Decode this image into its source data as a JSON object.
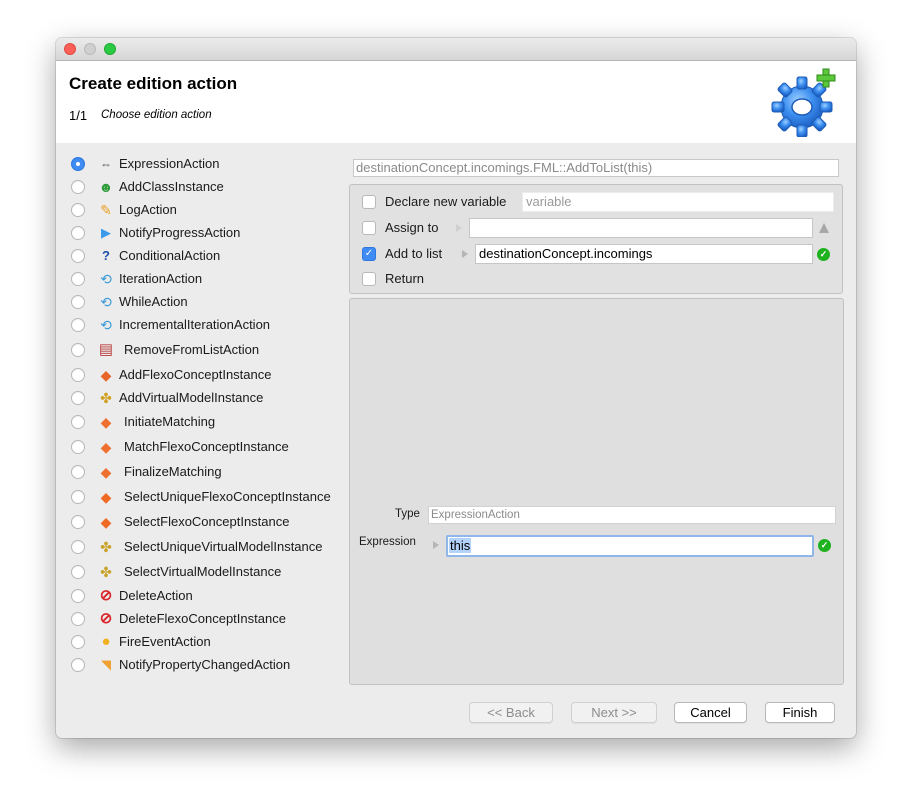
{
  "window": {
    "title": "Create edition action",
    "step": "1/1",
    "step_description": "Choose edition action",
    "header_icon": "gear-add-icon"
  },
  "actions": [
    {
      "label": "ExpressionAction",
      "icon": "expression-icon",
      "selected": true
    },
    {
      "label": "AddClassInstance",
      "icon": "add-class-icon",
      "selected": false
    },
    {
      "label": "LogAction",
      "icon": "pencil-icon",
      "selected": false
    },
    {
      "label": "NotifyProgressAction",
      "icon": "play-triangle-icon",
      "selected": false
    },
    {
      "label": "ConditionalAction",
      "icon": "question-icon",
      "selected": false
    },
    {
      "label": "IterationAction",
      "icon": "loop-icon",
      "selected": false
    },
    {
      "label": "WhileAction",
      "icon": "loop-icon",
      "selected": false
    },
    {
      "label": "IncrementalIterationAction",
      "icon": "loop-icon",
      "selected": false
    },
    {
      "label": "RemoveFromListAction",
      "icon": "remove-from-list-icon",
      "selected": false
    },
    {
      "label": "AddFlexoConceptInstance",
      "icon": "add-flexo-concept-icon",
      "selected": false
    },
    {
      "label": "AddVirtualModelInstance",
      "icon": "add-virtual-model-icon",
      "selected": false
    },
    {
      "label": "InitiateMatching",
      "icon": "matching-icon",
      "selected": false
    },
    {
      "label": "MatchFlexoConceptInstance",
      "icon": "matching-icon",
      "selected": false
    },
    {
      "label": "FinalizeMatching",
      "icon": "matching-icon",
      "selected": false
    },
    {
      "label": "SelectUniqueFlexoConceptInstance",
      "icon": "select-flexo-concept-icon",
      "selected": false
    },
    {
      "label": "SelectFlexoConceptInstance",
      "icon": "select-flexo-concept-icon",
      "selected": false
    },
    {
      "label": "SelectUniqueVirtualModelInstance",
      "icon": "select-virtual-model-icon",
      "selected": false
    },
    {
      "label": "SelectVirtualModelInstance",
      "icon": "select-virtual-model-icon",
      "selected": false
    },
    {
      "label": "DeleteAction",
      "icon": "delete-icon",
      "selected": false
    },
    {
      "label": "DeleteFlexoConceptInstance",
      "icon": "delete-icon",
      "selected": false
    },
    {
      "label": "FireEventAction",
      "icon": "fire-event-icon",
      "selected": false
    },
    {
      "label": "NotifyPropertyChangedAction",
      "icon": "notify-property-icon",
      "selected": false
    }
  ],
  "summary": "destinationConcept.incomings.FML::AddToList(this)",
  "options": {
    "declare_variable": {
      "label": "Declare new variable",
      "checked": false,
      "placeholder": "variable",
      "value": ""
    },
    "assign_to": {
      "label": "Assign to",
      "checked": false,
      "value": "",
      "status": "warning"
    },
    "add_to_list": {
      "label": "Add to list",
      "checked": true,
      "value": "destinationConcept.incomings",
      "status": "valid"
    },
    "return": {
      "label": "Return",
      "checked": false
    }
  },
  "details": {
    "type_label": "Type",
    "type_value": "ExpressionAction",
    "expression_label": "Expression",
    "expression_value": "this",
    "expression_status": "valid"
  },
  "buttons": {
    "back": "<< Back",
    "next": "Next >>",
    "cancel": "Cancel",
    "finish": "Finish"
  },
  "colors": {
    "accent": "#3f8cf5",
    "valid": "#1fb21f",
    "close": "#fc5f57",
    "zoom": "#2acb42"
  }
}
